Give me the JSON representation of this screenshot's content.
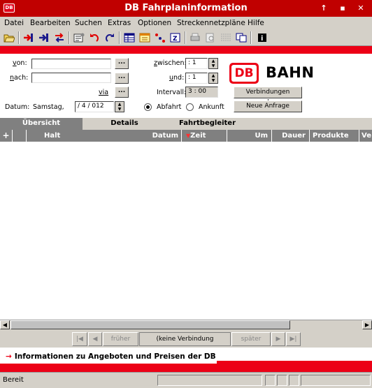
{
  "window": {
    "title": "DB Fahrplaninformation",
    "app_badge": "DB",
    "controls": [
      "↑",
      "▪",
      "✕"
    ]
  },
  "menu": [
    {
      "label": "Datei"
    },
    {
      "label": "Bearbeiten"
    },
    {
      "label": "Suchen"
    },
    {
      "label": "Extras"
    },
    {
      "label": "Optionen"
    },
    {
      "label": "Streckennetzpläne"
    },
    {
      "label": "Hilfe"
    }
  ],
  "toolbar": {
    "icons": [
      "open-folder-icon",
      "departure-arrow-icon",
      "arrival-arrow-icon",
      "swap-icon",
      "properties-icon",
      "undo-icon",
      "redo-icon",
      "timetable-icon",
      "calendar-icon",
      "route-icon",
      "zoom-icon",
      "print-icon",
      "print-preview-icon",
      "grid-icon",
      "copy-icon",
      "info-icon"
    ]
  },
  "search": {
    "von_label": "von:",
    "nach_label": "nach:",
    "via_label": "via",
    "von_value": "",
    "nach_value": "",
    "dots": "...",
    "datum_label": "Datum:",
    "day": "Samstag,",
    "date_value": "/ 4  / 012",
    "zwischen_label": "zwischen:",
    "zwischen_value": ": 1",
    "und_label": "und:",
    "und_value": ": 1",
    "intervall_label": "Intervall:",
    "intervall_value": "3 : 00",
    "search_button": "Verbindungen suchen",
    "new_button": "Neue Anfrage",
    "abfahrt_label": "Abfahrt",
    "ankunft_label": "Ankunft",
    "abfahrt_selected": true
  },
  "brand": {
    "logo": "DB",
    "name": "BAHN",
    "color": "#ec0016"
  },
  "tabs": [
    {
      "label": "Übersicht",
      "active": true
    },
    {
      "label": "Details",
      "active": false
    },
    {
      "label": "Fahrtbegleiter",
      "active": false
    }
  ],
  "table": {
    "expand": "+",
    "columns": [
      "Halt",
      "Datum",
      "Zeit",
      "Um",
      "Dauer",
      "Produkte",
      "Ve"
    ],
    "rows": []
  },
  "nav": {
    "first": "|◀",
    "prev_arrow": "◀",
    "prev": "früher",
    "status": "(keine Verbindung gefunden)",
    "next": "später",
    "next_arrow": "▶",
    "last": "▶|"
  },
  "info": {
    "arrow": "→",
    "text": "Informationen zu Angeboten und Preisen der DB"
  },
  "status": {
    "text": "Bereit"
  }
}
